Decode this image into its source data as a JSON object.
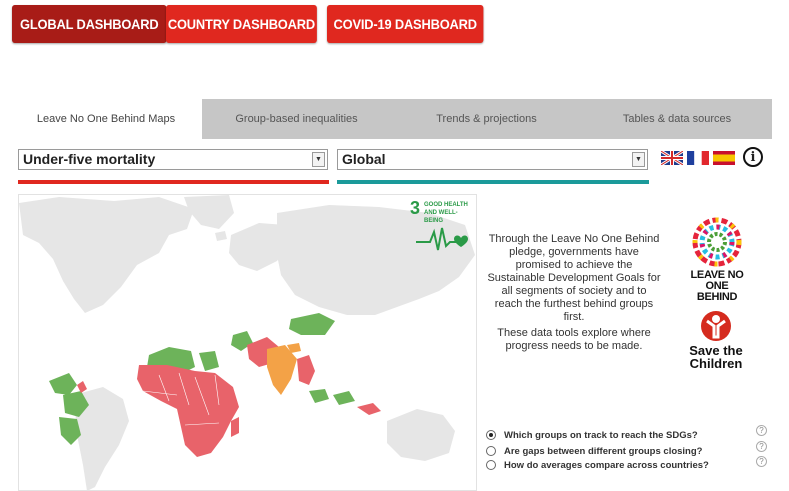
{
  "top_nav": {
    "global": "GLOBAL DASHBOARD",
    "country": "COUNTRY DASHBOARD",
    "covid": "COVID-19 DASHBOARD"
  },
  "tabs": [
    {
      "label": "Leave No One Behind Maps",
      "active": true
    },
    {
      "label": "Group-based inequalities",
      "active": false
    },
    {
      "label": "Trends & projections",
      "active": false
    },
    {
      "label": "Tables & data sources",
      "active": false
    }
  ],
  "filters": {
    "indicator": "Under-five mortality",
    "region": "Global"
  },
  "colors": {
    "accent_red": "#e0281f",
    "dark_red": "#a81c17",
    "teal": "#1b9a9a",
    "on_track_green": "#6db35a",
    "off_track_red": "#e8636a",
    "orange": "#f3a247",
    "land_grey": "#e6e6e6"
  },
  "languages": [
    "english-flag",
    "french-flag",
    "spanish-flag"
  ],
  "sdg": {
    "number": "3",
    "label_line1": "GOOD HEALTH",
    "label_line2": "AND WELL-BEING"
  },
  "intro": {
    "paragraph1": "Through the Leave No One Behind pledge, governments have promised to achieve the Sustainable Development Goals for all segments of society and to reach the furthest behind groups first.",
    "paragraph2": "These data tools explore where progress needs to be made."
  },
  "logos": {
    "lnob_line1": "LEAVE NO ONE",
    "lnob_line2": "BEHIND",
    "stc_line1": "Save the",
    "stc_line2": "Children"
  },
  "questions": [
    {
      "label": "Which groups on track to reach the SDGs?",
      "selected": true
    },
    {
      "label": "Are gaps between different groups closing?",
      "selected": false
    },
    {
      "label": "How do averages compare across countries?",
      "selected": false
    }
  ],
  "help_symbol": "?",
  "info_symbol": "i"
}
